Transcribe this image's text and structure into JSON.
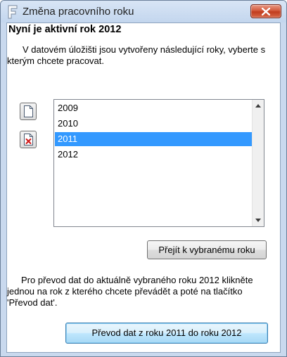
{
  "window": {
    "title": "Změna pracovního roku",
    "icon": "app-f-icon",
    "close_icon": "close-icon"
  },
  "heading": "Nyní je aktivní rok 2012",
  "info_text": "V datovém úložišti jsou vytvořeny následující roky, vyberte s kterým chcete pracovat.",
  "side_buttons": [
    {
      "name": "new-document-icon"
    },
    {
      "name": "delete-document-icon"
    }
  ],
  "years": {
    "items": [
      {
        "label": "2009",
        "selected": false
      },
      {
        "label": "2010",
        "selected": false
      },
      {
        "label": "2011",
        "selected": true
      },
      {
        "label": "2012",
        "selected": false
      }
    ],
    "selected_color": "#3399ff"
  },
  "go_button_label": "Přejít k vybranému roku",
  "transfer_text": "Pro převod dat do aktuálně vybraného roku 2012 klikněte jednou na rok z kterého chcete převádět a poté na tlačítko 'Převod dat'.",
  "transfer_button_label": "Převod dat z roku 2011 do roku 2012",
  "colors": {
    "title_bar": "#c9d9ee",
    "close_button": "#c94a2f",
    "default_button": "#bee6fd"
  }
}
